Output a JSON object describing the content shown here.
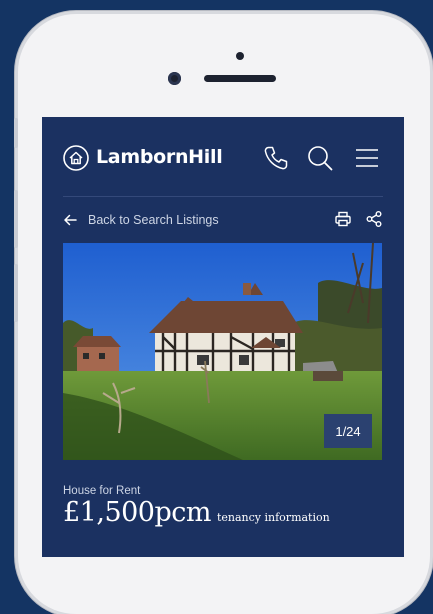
{
  "brand": {
    "name": "LambornHill",
    "logo_icon": "house-circle-icon"
  },
  "header": {
    "icons": [
      "phone-icon",
      "search-icon",
      "menu-icon"
    ]
  },
  "nav": {
    "back_label": "Back to Search Listings",
    "tools": [
      "print-icon",
      "share-icon"
    ]
  },
  "gallery": {
    "counter": "1/24",
    "current": 1,
    "total": 24
  },
  "listing": {
    "type": "House for Rent",
    "price": "£1,500pcm",
    "tenancy_link": "tenancy information"
  },
  "colors": {
    "page_background": "#143463",
    "screen_background": "#1b3161",
    "text": "#ffffff",
    "counter_background": "#2b4170"
  }
}
